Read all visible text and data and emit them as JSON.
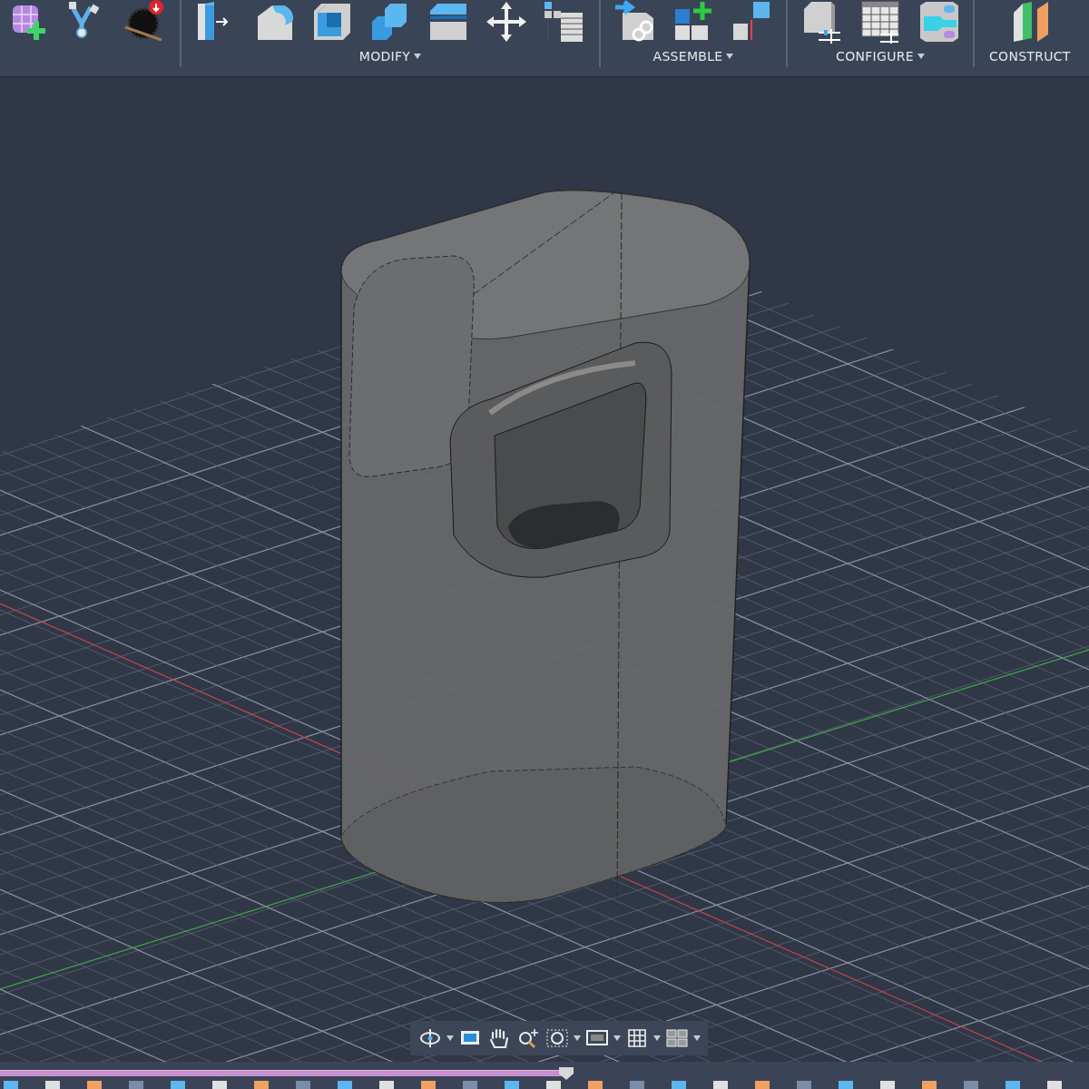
{
  "toolbar": {
    "groups": [
      {
        "label": "MODIFY",
        "dropdown": true
      },
      {
        "label": "ASSEMBLE",
        "dropdown": true
      },
      {
        "label": "CONFIGURE",
        "dropdown": true
      },
      {
        "label": "CONSTRUCT",
        "dropdown": false
      }
    ]
  },
  "timeline": {
    "level": 0.52
  }
}
